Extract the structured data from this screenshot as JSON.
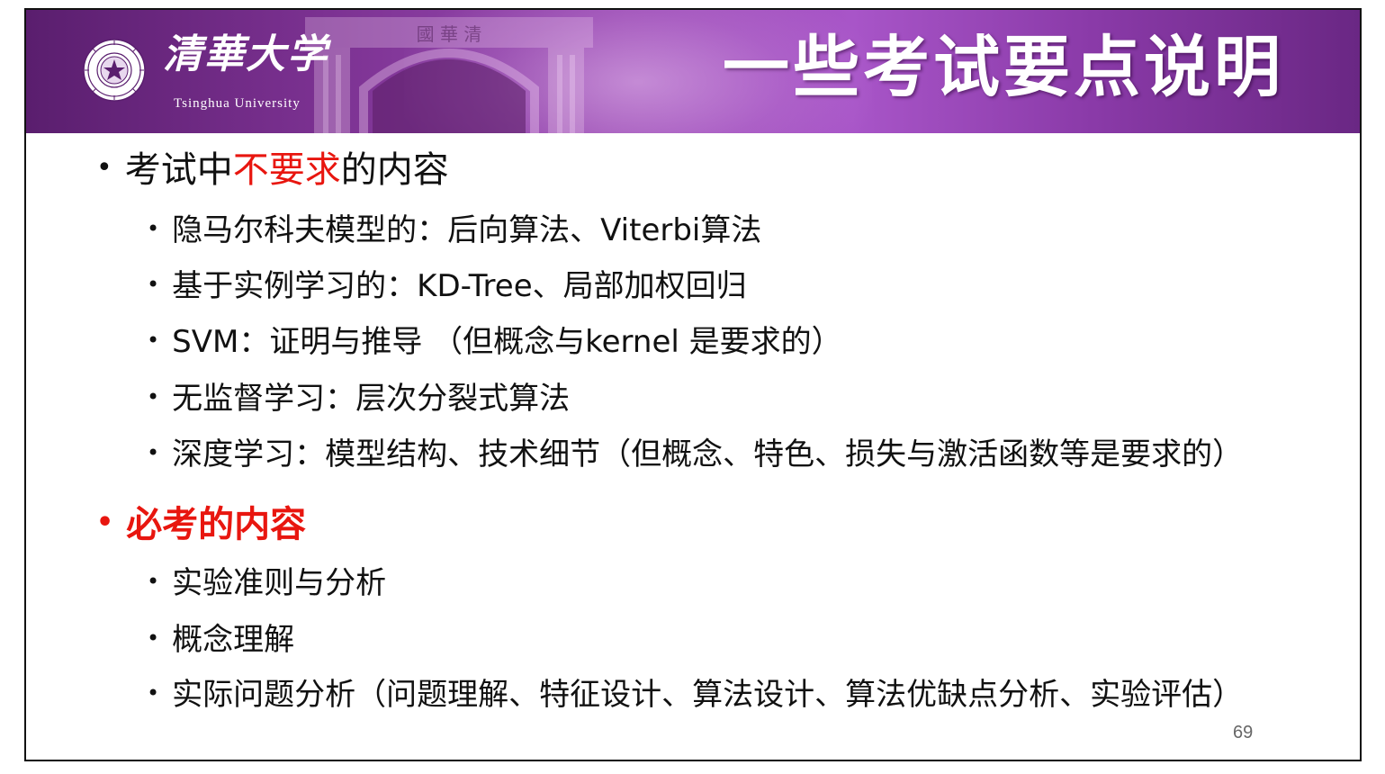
{
  "header": {
    "logo_script": "清華大学",
    "logo_english": "Tsinghua University",
    "title": "一些考试要点说明",
    "gate_inscription": "國 華 清"
  },
  "sections": [
    {
      "heading_prefix": "考试中",
      "heading_highlight": "不要求",
      "heading_suffix": "的内容",
      "items": [
        "隐马尔科夫模型的：后向算法、Viterbi算法",
        "基于实例学习的：KD-Tree、局部加权回归",
        "SVM：证明与推导 （但概念与kernel 是要求的）",
        "无监督学习：层次分裂式算法",
        "深度学习：模型结构、技术细节（但概念、特色、损失与激活函数等是要求的）"
      ]
    },
    {
      "heading": "必考的内容",
      "items": [
        "实验准则与分析",
        "概念理解",
        "实际问题分析（问题理解、特征设计、算法设计、算法优缺点分析、实验评估）"
      ]
    }
  ],
  "bullet_glyph": "•",
  "page_number": "69",
  "colors": {
    "banner_purple": "#8a3aa8",
    "highlight_red": "#e8160f",
    "text": "#111111"
  },
  "icons": {
    "seal": "tsinghua-seal-icon"
  }
}
